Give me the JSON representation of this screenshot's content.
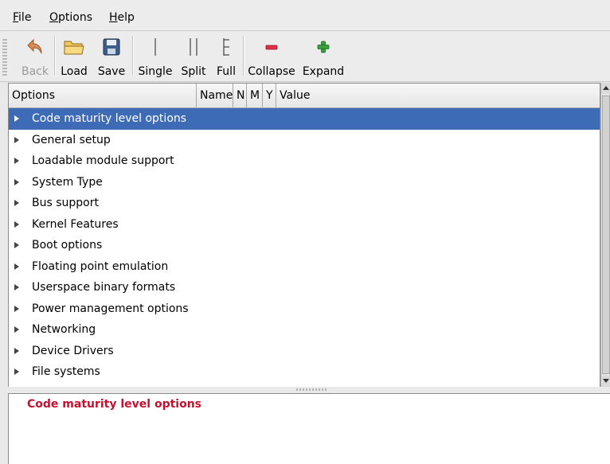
{
  "menubar": {
    "items": [
      {
        "label": "File"
      },
      {
        "label": "Options"
      },
      {
        "label": "Help"
      }
    ]
  },
  "toolbar": {
    "back_label": "Back",
    "load_label": "Load",
    "save_label": "Save",
    "single_label": "Single",
    "split_label": "Split",
    "full_label": "Full",
    "collapse_label": "Collapse",
    "expand_label": "Expand"
  },
  "tree": {
    "columns": [
      "Options",
      "Name",
      "N",
      "M",
      "Y",
      "Value"
    ],
    "rows": [
      {
        "label": "Code maturity level options",
        "selected": true
      },
      {
        "label": "General setup"
      },
      {
        "label": "Loadable module support"
      },
      {
        "label": "System Type"
      },
      {
        "label": "Bus support"
      },
      {
        "label": "Kernel Features"
      },
      {
        "label": "Boot options"
      },
      {
        "label": "Floating point emulation"
      },
      {
        "label": "Userspace binary formats"
      },
      {
        "label": "Power management options"
      },
      {
        "label": "Networking"
      },
      {
        "label": "Device Drivers"
      },
      {
        "label": "File systems"
      }
    ]
  },
  "help": {
    "title": "Code maturity level options"
  },
  "colors": {
    "selection": "#3e6bb5",
    "help_title": "#c8102e",
    "collapse_icon": "#e0304a",
    "expand_icon": "#3aa13a"
  }
}
